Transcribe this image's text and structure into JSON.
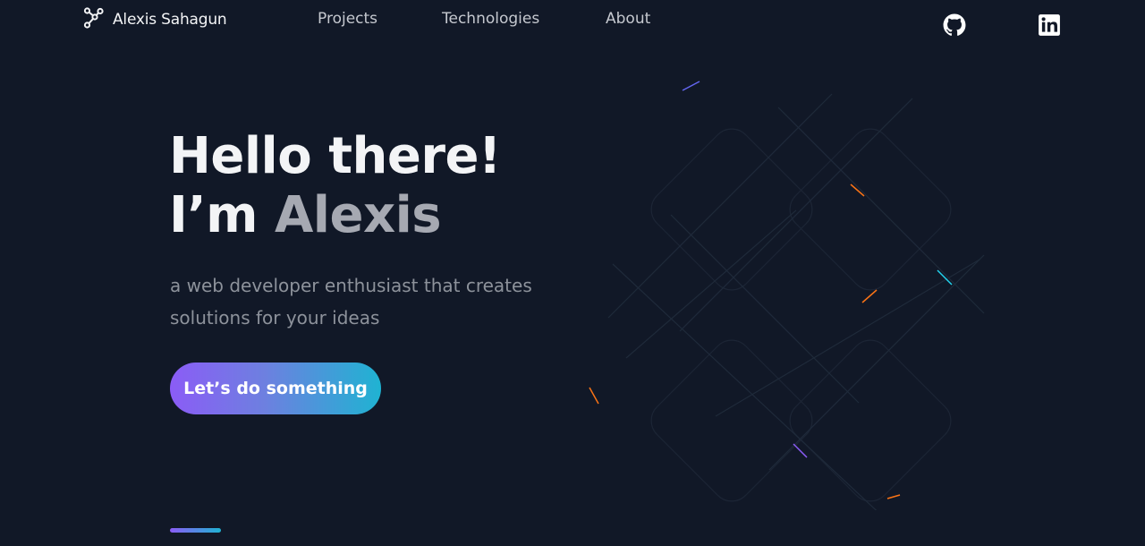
{
  "nav": {
    "brand_name": "Alexis Sahagun",
    "links": [
      "Projects",
      "Technologies",
      "About"
    ],
    "icons": {
      "brand": "network-logo-icon",
      "github": "github-icon",
      "linkedin": "linkedin-icon"
    }
  },
  "hero": {
    "greeting": "Hello there!",
    "intro_prefix": "I’m ",
    "intro_name": "Alexis",
    "subtitle": "a web developer enthusiast that creates solutions for your ideas",
    "cta_label": "Let’s do something"
  },
  "colors": {
    "background": "#111827",
    "gradient_start": "#8b5cf6",
    "gradient_end": "#1fb3d2"
  }
}
